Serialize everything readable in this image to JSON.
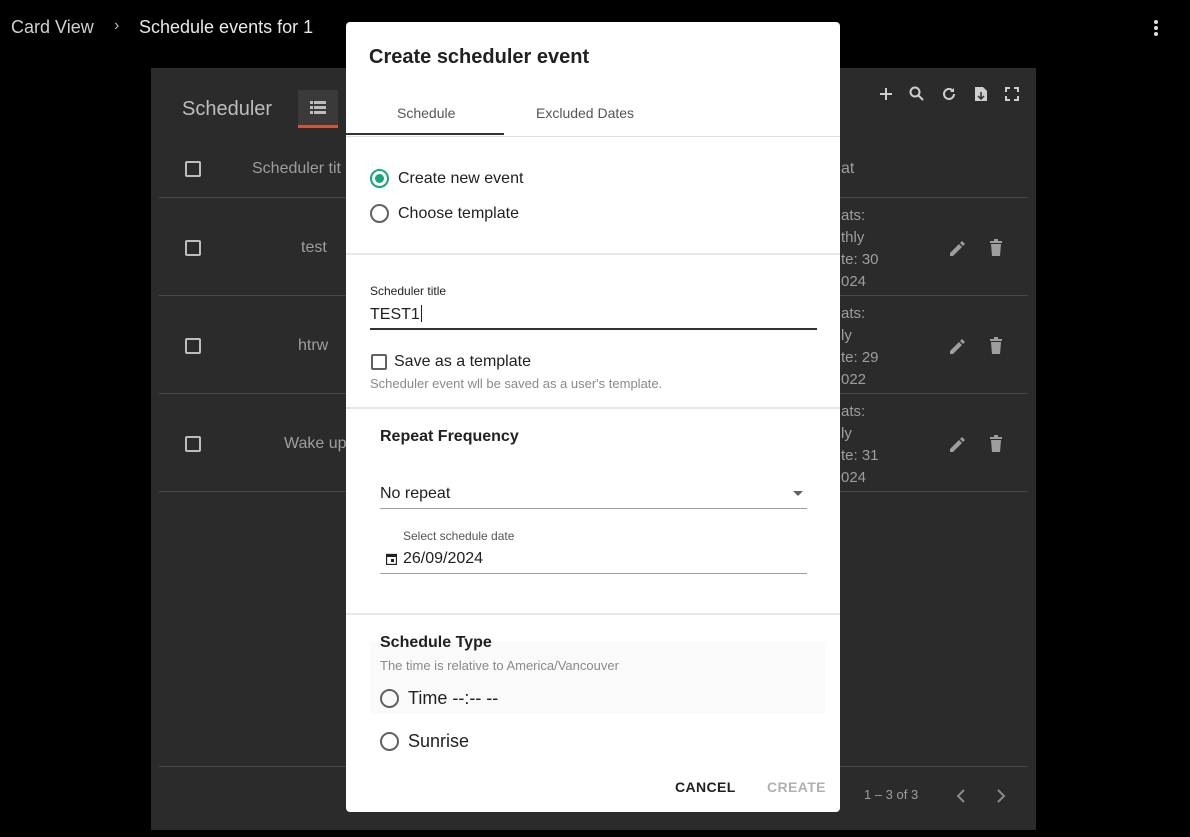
{
  "breadcrumb": {
    "parent": "Card View",
    "separator": "›",
    "current": "Schedule events for 1"
  },
  "background_card": {
    "title": "Scheduler",
    "columns": [
      "Scheduler tit",
      "at"
    ],
    "rows": [
      {
        "name": "test",
        "repeat_lines": [
          "ats:",
          "thly",
          "te: 30",
          "024"
        ]
      },
      {
        "name": "htrw",
        "repeat_lines": [
          "ats:",
          "ly",
          "te: 29",
          "022"
        ]
      },
      {
        "name": "Wake up",
        "repeat_lines": [
          "ats:",
          "ly",
          "te: 31",
          "024"
        ]
      }
    ],
    "pagination": "1 – 3 of 3"
  },
  "modal": {
    "title": "Create scheduler event",
    "tabs": [
      "Schedule",
      "Excluded Dates"
    ],
    "mode_options": [
      {
        "label": "Create new event",
        "selected": true
      },
      {
        "label": "Choose template",
        "selected": false
      }
    ],
    "scheduler_title_label": "Scheduler title",
    "scheduler_title_value": "TEST1",
    "save_template_label": "Save as a template",
    "save_template_hint": "Scheduler event wll be saved as a user's template.",
    "repeat_frequency_title": "Repeat Frequency",
    "repeat_value": "No repeat",
    "date_label": "Select schedule date",
    "date_value": "26/09/2024",
    "schedule_type_title": "Schedule Type",
    "schedule_type_hint": "The time is relative to America/Vancouver",
    "schedule_type_options": [
      {
        "label": "Time --:-- --",
        "selected": false
      },
      {
        "label": "Sunrise",
        "selected": false
      }
    ],
    "cancel_label": "CANCEL",
    "create_label": "CREATE"
  },
  "colors": {
    "accent": "#1aa57a",
    "tab_indicator": "#d0553a"
  }
}
